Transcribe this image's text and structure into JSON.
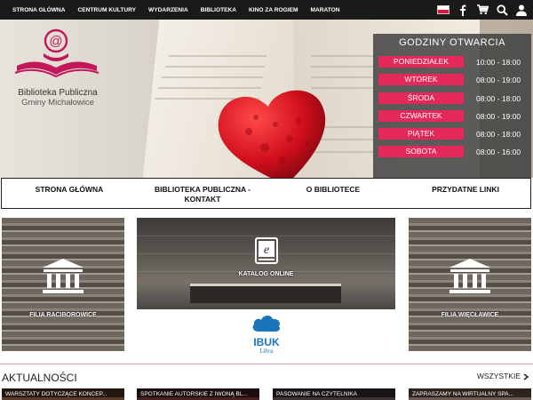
{
  "topnav": {
    "items": [
      {
        "label": "STRONA GŁÓWNA"
      },
      {
        "label": "CENTRUM KULTURY"
      },
      {
        "label": "WYDARZENIA"
      },
      {
        "label": "BIBLIOTEKA"
      },
      {
        "label": "KINO ZA ROGIEM"
      },
      {
        "label": "MARATON"
      }
    ],
    "icons": [
      "polish-flag-icon",
      "facebook-icon",
      "cart-icon",
      "search-icon",
      "user-icon"
    ]
  },
  "logo": {
    "title": "Biblioteka Publiczna",
    "subtitle": "Gminy Michałowice"
  },
  "hours": {
    "title": "GODZINY OTWARCIA",
    "rows": [
      {
        "day": "PONIEDZIAŁEK",
        "time": "10:00 - 18:00"
      },
      {
        "day": "WTOREK",
        "time": "08:00 - 19:00"
      },
      {
        "day": "ŚRODA",
        "time": "08:00 - 18:00"
      },
      {
        "day": "CZWARTEK",
        "time": "08:00 - 19:00"
      },
      {
        "day": "PIĄTEK",
        "time": "08:00 - 18:00"
      },
      {
        "day": "SOBOTA",
        "time": "08:00 - 16:00"
      }
    ]
  },
  "mainnav": {
    "home": "STRONA GŁÓWNA",
    "library": "BIBLIOTEKA PUBLICZNA - KONTAKT",
    "about": "O BIBLIOTECE",
    "links": "PRZYDATNE LINKI"
  },
  "tiles": {
    "left": "FILIA RACIBOROWICE",
    "catalog": "KATALOG ONLINE",
    "right": "FILIA WIĘCŁAWICE",
    "ibuk_name": "IBUK",
    "ibuk_sub": "Libra"
  },
  "news": {
    "title": "AKTUALNOŚCI",
    "all": "WSZYSTKIE",
    "cards": [
      "WARSZTATY DOTYCZĄCE KONCEP...",
      "SPOTKANIE AUTORSKIE Z IWONĄ BL...",
      "PASOWANIE NA CZYTELNIKA",
      "ZAPRASZAMY NA WIRTUALNY SPA..."
    ]
  },
  "colors": {
    "accent": "#e4285a",
    "topbar": "#1a1a1a"
  }
}
